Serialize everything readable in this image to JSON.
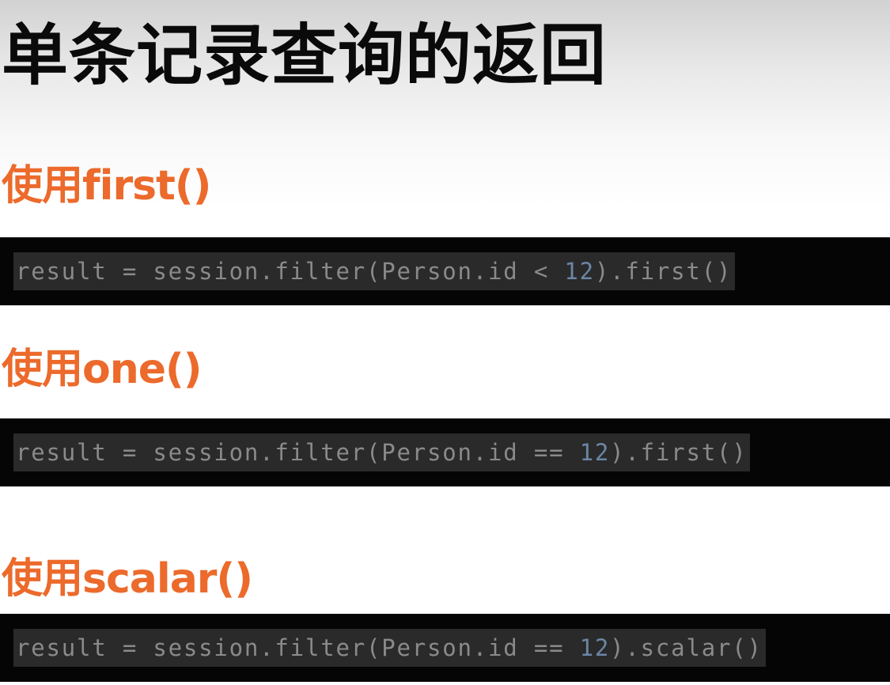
{
  "slide": {
    "title": "单条记录查询的返回"
  },
  "sections": [
    {
      "heading": "使用first()",
      "code": {
        "before": "result = session.filter(Person.id < ",
        "number": "12",
        "after": ").first()"
      }
    },
    {
      "heading": "使用one()",
      "code": {
        "before": "result = session.filter(Person.id == ",
        "number": "12",
        "after": ").first()"
      }
    },
    {
      "heading": "使用scalar()",
      "code": {
        "before": "result = session.filter(Person.id == ",
        "number": "12",
        "after": ").scalar()"
      }
    }
  ],
  "colors": {
    "heading": "#ec6a2b",
    "code_background": "#050505",
    "code_line_background": "#2a2a2a",
    "code_text": "#8a8a8a",
    "code_number": "#6b86a6"
  }
}
